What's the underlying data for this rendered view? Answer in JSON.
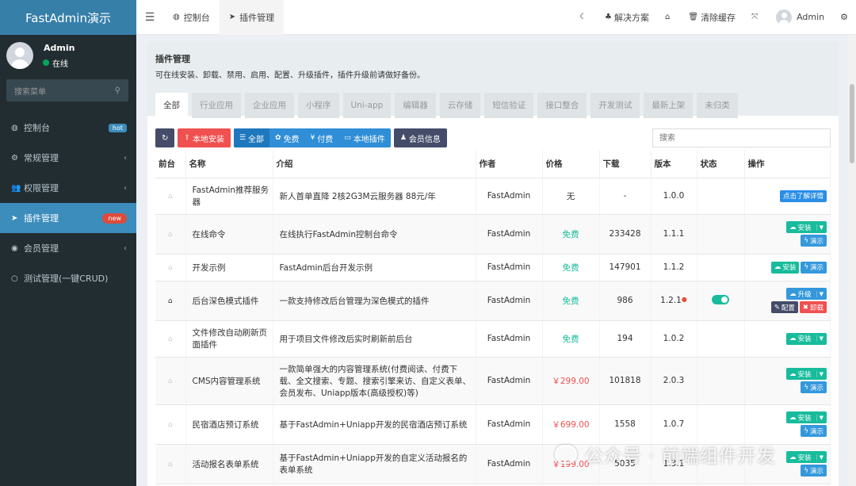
{
  "sidebar": {
    "brand": "FastAdmin演示",
    "user": {
      "name": "Admin",
      "status": "在线"
    },
    "search_placeholder": "搜索菜单",
    "items": [
      {
        "icon": "dashboard-icon",
        "glyph": "◍",
        "label": "控制台",
        "badge": "hot",
        "badge_color": "#3c8dbc"
      },
      {
        "icon": "cogs-icon",
        "glyph": "⚙",
        "label": "常规管理",
        "chevron": "‹"
      },
      {
        "icon": "group-icon",
        "glyph": "👥",
        "label": "权限管理",
        "chevron": "‹"
      },
      {
        "icon": "rocket-icon",
        "glyph": "➤",
        "label": "插件管理",
        "badge": "new",
        "badge_color": "#dd4b39",
        "active": true
      },
      {
        "icon": "user-circle-icon",
        "glyph": "◉",
        "label": "会员管理",
        "chevron": "‹"
      },
      {
        "icon": "circle-icon",
        "glyph": "○",
        "label": "测试管理(一键CRUD)"
      }
    ]
  },
  "topbar": {
    "tabs": [
      {
        "glyph": "◍",
        "label": "控制台"
      },
      {
        "glyph": "➤",
        "label": "插件管理",
        "active": true
      }
    ],
    "right": [
      {
        "glyph": "☾",
        "label": ""
      },
      {
        "glyph": "♣",
        "label": "解决方案"
      },
      {
        "glyph": "⌂",
        "label": ""
      },
      {
        "glyph": "🗑",
        "label": "清除缓存"
      },
      {
        "glyph": "⤧",
        "label": ""
      }
    ],
    "admin_name": "Admin",
    "settings_glyph": "⚙"
  },
  "panel": {
    "title": "插件管理",
    "description": "可在线安装、卸载、禁用、启用、配置、升级插件，插件升级前请做好备份。",
    "categories": [
      "全部",
      "行业应用",
      "企业应用",
      "小程序",
      "Uni-app",
      "编辑器",
      "云存储",
      "短信验证",
      "接口整合",
      "开发测试",
      "最新上架",
      "未归类"
    ],
    "toolbar": {
      "refresh_glyph": "↻",
      "local_install": "本地安装",
      "filters": [
        "全部",
        "免费",
        "付费",
        "本地插件"
      ],
      "member_info": "会员信息",
      "search_placeholder": "搜索"
    },
    "columns": [
      "前台",
      "名称",
      "介绍",
      "作者",
      "价格",
      "下载",
      "版本",
      "状态",
      "操作"
    ],
    "rows": [
      {
        "front_on": false,
        "name": "FastAdmin推荐服务器",
        "intro": "新人首单直降 2核2G3M云服务器 88元/年",
        "author": "FastAdmin",
        "price": "无",
        "price_type": "none",
        "downloads": "-",
        "version": "1.0.0",
        "ops": "detail"
      },
      {
        "front_on": false,
        "name": "在线命令",
        "intro": "在线执行FastAdmin控制台命令",
        "author": "FastAdmin",
        "price": "免费",
        "price_type": "free",
        "downloads": "233428",
        "version": "1.1.1",
        "ops": "install-stack"
      },
      {
        "front_on": false,
        "name": "开发示例",
        "intro": "FastAdmin后台开发示例",
        "author": "FastAdmin",
        "price": "免费",
        "price_type": "free",
        "downloads": "147901",
        "version": "1.1.2",
        "ops": "install-inline"
      },
      {
        "front_on": true,
        "name": "后台深色模式插件",
        "intro": "一款支持修改后台管理为深色模式的插件",
        "author": "FastAdmin",
        "price": "免费",
        "price_type": "free",
        "downloads": "986",
        "version": "1.2.1",
        "version_dot": true,
        "status": "on",
        "ops": "upgrade"
      },
      {
        "front_on": false,
        "name": "文件修改自动刷新页面插件",
        "intro": "用于项目文件修改后实时刷新前后台",
        "author": "FastAdmin",
        "price": "免费",
        "price_type": "free",
        "downloads": "194",
        "version": "1.0.2",
        "ops": "install-only"
      },
      {
        "front_on": false,
        "name": "CMS内容管理系统",
        "intro": "一款简单强大的内容管理系统(付费阅读、付费下载、全文搜索、专题、搜索引擎来访、自定义表单、会员发布、Uniapp版本(高级授权)等)",
        "author": "FastAdmin",
        "price": "￥299.00",
        "price_type": "paid",
        "downloads": "101818",
        "version": "2.0.3",
        "ops": "install-stack"
      },
      {
        "front_on": false,
        "name": "民宿酒店预订系统",
        "intro": "基于FastAdmin+Uniapp开发的民宿酒店预订系统",
        "author": "FastAdmin",
        "price": "￥699.00",
        "price_type": "paid",
        "downloads": "1558",
        "version": "1.0.7",
        "ops": "install-stack"
      },
      {
        "front_on": false,
        "name": "活动报名表单系统",
        "intro": "基于FastAdmin+Uniapp开发的自定义活动报名的表单系统",
        "author": "FastAdmin",
        "price": "￥199.00",
        "price_type": "paid",
        "downloads": "5035",
        "version": "1.3.1",
        "ops": "install-stack"
      }
    ],
    "op_labels": {
      "detail": "点击了解详情",
      "install": "安装",
      "demo": "演示",
      "upgrade": "升级",
      "config": "配置",
      "uninstall": "卸载"
    }
  },
  "watermark": "公众号 · 前端组件开发",
  "colors": {
    "sidebar_bg": "#222d32",
    "brand_bg": "#367fa9",
    "active": "#3c8dbc",
    "free": "#18bc9c",
    "paid": "#f05050"
  }
}
